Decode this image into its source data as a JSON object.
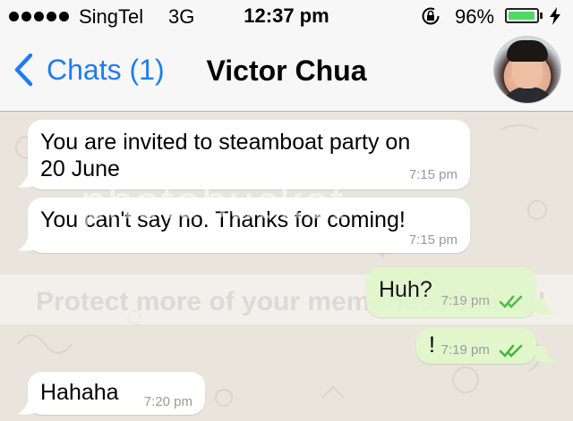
{
  "status_bar": {
    "carrier": "SingTel",
    "network": "3G",
    "time": "12:37 pm",
    "battery_percent": "96%",
    "battery_level": 0.96,
    "signal_bars": 5,
    "icons": [
      "orientation-lock-icon",
      "charging-bolt-icon"
    ]
  },
  "nav": {
    "back_label": "Chats (1)",
    "title": "Victor Chua"
  },
  "watermark": {
    "logo": "photobucket",
    "banner": "Protect more of your memories for less!"
  },
  "messages": [
    {
      "direction": "in",
      "text_lines": [
        "You are invited to steamboat party on",
        "20 June"
      ],
      "time": "7:15 pm"
    },
    {
      "direction": "in",
      "text_lines": [
        "You can't say no. Thanks for coming!"
      ],
      "time": "7:15 pm"
    },
    {
      "direction": "out",
      "text_lines": [
        "Huh?"
      ],
      "time": "7:19 pm",
      "status": "read-ticks-icon"
    },
    {
      "direction": "out",
      "text_lines": [
        "!"
      ],
      "time": "7:19 pm",
      "status": "read-ticks-icon"
    },
    {
      "direction": "in",
      "text_lines": [
        "Hahaha"
      ],
      "time": "7:20 pm"
    }
  ],
  "colors": {
    "accent": "#1e7cf2",
    "outgoing_bubble": "#e1f7cb",
    "incoming_bubble": "#ffffff",
    "chat_background": "#e9e4dc",
    "battery": "#4cd964",
    "ticks": "#46b83b"
  }
}
